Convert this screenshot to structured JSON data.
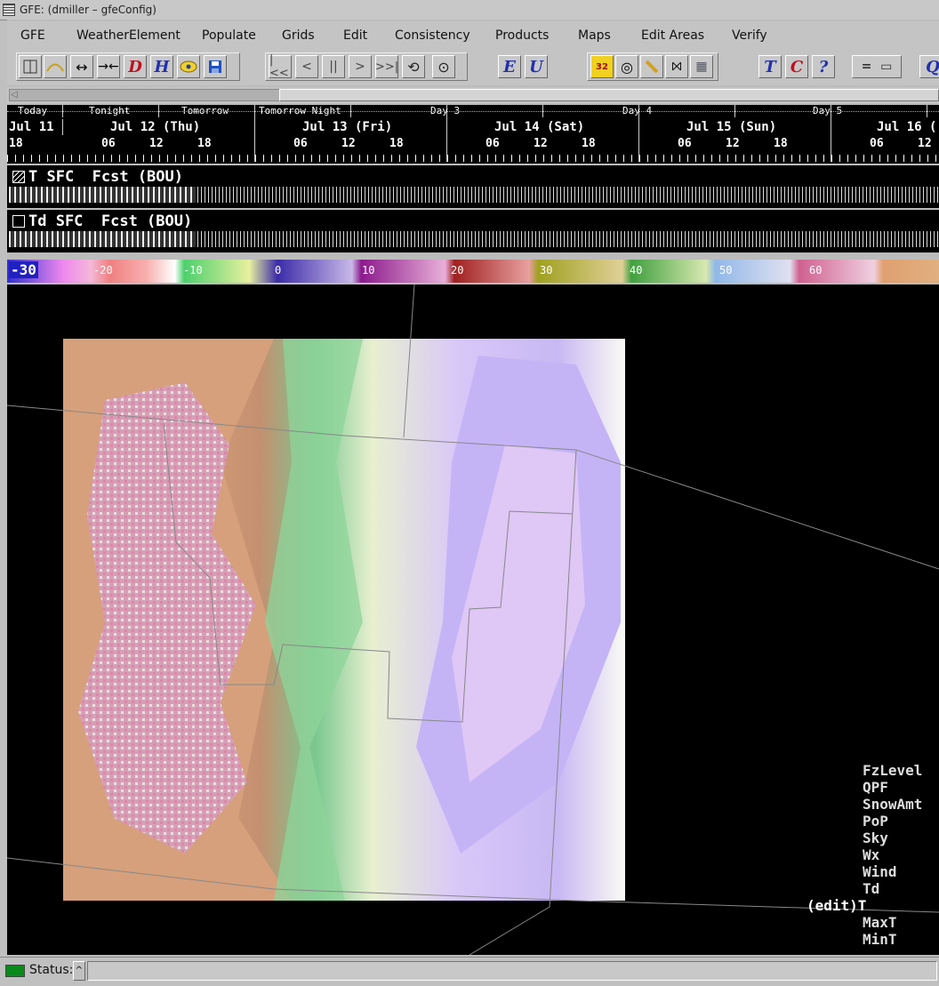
{
  "window": {
    "title": "GFE: (dmiller – gfeConfig)"
  },
  "menubar": {
    "items": [
      {
        "label": "GFE",
        "key": "G"
      },
      {
        "label": "WeatherElement",
        "key": "W"
      },
      {
        "label": "Populate",
        "key": "P"
      },
      {
        "label": "Grids",
        "key": "G"
      },
      {
        "label": "Edit",
        "key": "E"
      },
      {
        "label": "Consistency",
        "key": "C"
      },
      {
        "label": "Products",
        "key": "P"
      },
      {
        "label": "Maps",
        "key": "M"
      },
      {
        "label": "Edit Areas",
        "key": "E"
      },
      {
        "label": "Verify",
        "key": "V"
      }
    ]
  },
  "toolbar": {
    "d_label": "D",
    "h_label": "H",
    "e_label": "E",
    "u_label": "U",
    "badge_32": "32",
    "t_label": "T",
    "c_label": "C",
    "help_label": "?",
    "equals_label": "=",
    "q_label": "Q"
  },
  "timescale": {
    "periods": [
      "Today",
      "Tonight",
      "Tomorrow",
      "Tomorrow Night",
      "Day 3",
      "Day 4",
      "Day 5"
    ],
    "dates": [
      "Jul 11",
      "Jul 12 (Thu)",
      "Jul 13 (Fri)",
      "Jul 14 (Sat)",
      "Jul 15 (Sun)",
      "Jul 16 ("
    ],
    "hours": [
      "18",
      "06",
      "12",
      "18",
      "06",
      "12",
      "18",
      "06",
      "12",
      "18",
      "06",
      "12",
      "18",
      "06",
      "12"
    ]
  },
  "grids": [
    {
      "name": "T SFC  Fcst (BOU)",
      "selected": true
    },
    {
      "name": "Td SFC  Fcst (BOU)",
      "selected": false
    }
  ],
  "colorbar": {
    "first": "-30",
    "labels": [
      "-20",
      "-10",
      "0",
      "10",
      "20",
      "30",
      "40",
      "50",
      "60"
    ]
  },
  "legend": {
    "items": [
      "FzLevel",
      "QPF",
      "SnowAmt",
      "PoP",
      "Sky",
      "Wx",
      "Wind",
      "Td",
      "(edit)T",
      "MaxT",
      "MinT"
    ]
  },
  "status": {
    "label": "Status:",
    "button": "^"
  }
}
